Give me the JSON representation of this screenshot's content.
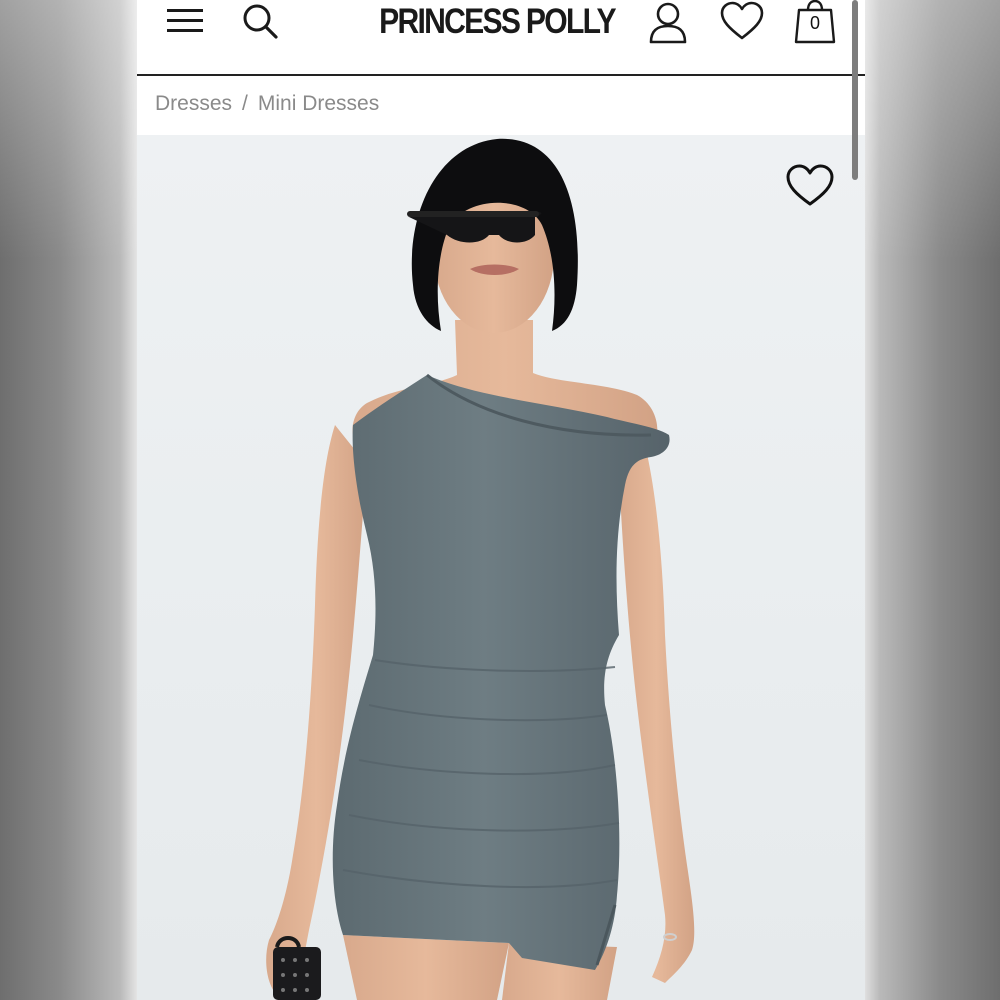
{
  "header": {
    "brand": "PRINCESS POLLY",
    "bag_count": "0",
    "icons": {
      "menu": "hamburger-menu-icon",
      "search": "search-icon",
      "account": "user-account-icon",
      "wishlist": "heart-icon",
      "bag": "shopping-bag-icon"
    }
  },
  "breadcrumb": {
    "items": [
      "Dresses",
      "Mini Dresses"
    ],
    "separator": "/"
  },
  "product_image": {
    "wishlist_icon": "heart-outline-icon",
    "dress_color": "#6b7a80",
    "background_color": "#eef1f3"
  },
  "colors": {
    "text_primary": "#1a1a1a",
    "breadcrumb_text": "#8a8a8a",
    "header_rule": "#222222"
  }
}
